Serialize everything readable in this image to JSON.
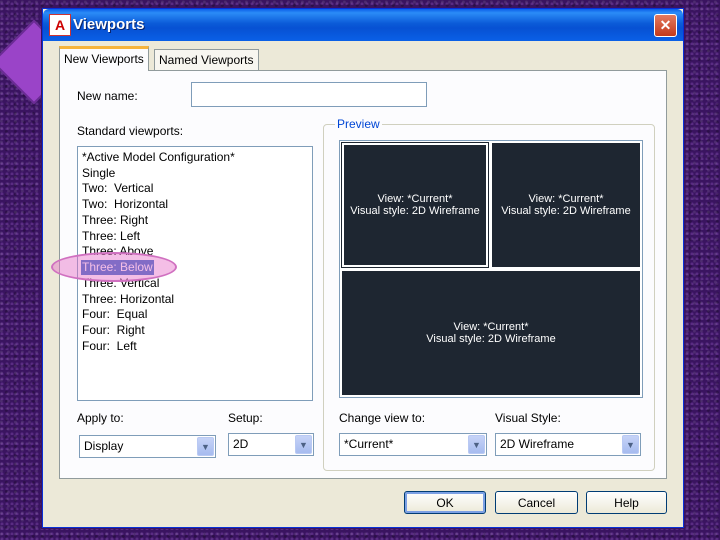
{
  "window": {
    "title": "Viewports"
  },
  "tabs": [
    {
      "label": "New Viewports",
      "active": true
    },
    {
      "label": "Named Viewports",
      "active": false
    }
  ],
  "new_name": {
    "label": "New name:",
    "value": ""
  },
  "standard_viewports": {
    "label": "Standard viewports:",
    "items": [
      "*Active Model Configuration*",
      "Single",
      "Two:  Vertical",
      "Two:  Horizontal",
      "Three: Right",
      "Three: Left",
      "Three: Above",
      "Three: Below",
      "Three: Vertical",
      "Three: Horizontal",
      "Four:  Equal",
      "Four:  Right",
      "Four:  Left"
    ],
    "selected": "Three: Below"
  },
  "preview": {
    "label": "Preview",
    "viewports": [
      {
        "line1": "View: *Current*",
        "line2": "Visual style: 2D Wireframe"
      },
      {
        "line1": "View: *Current*",
        "line2": "Visual style: 2D Wireframe"
      },
      {
        "line1": "View: *Current*",
        "line2": "Visual style: 2D Wireframe"
      }
    ]
  },
  "apply_to": {
    "label": "Apply to:",
    "value": "Display"
  },
  "setup": {
    "label": "Setup:",
    "value": "2D"
  },
  "change_view_to": {
    "label": "Change view to:",
    "value": "*Current*"
  },
  "visual_style": {
    "label": "Visual Style:",
    "value": "2D Wireframe"
  },
  "buttons": {
    "ok": "OK",
    "cancel": "Cancel",
    "help": "Help"
  },
  "colors": {
    "accent": "#0a5fe8",
    "selection": "#316ac5",
    "viewport_bg": "#1e2631"
  }
}
